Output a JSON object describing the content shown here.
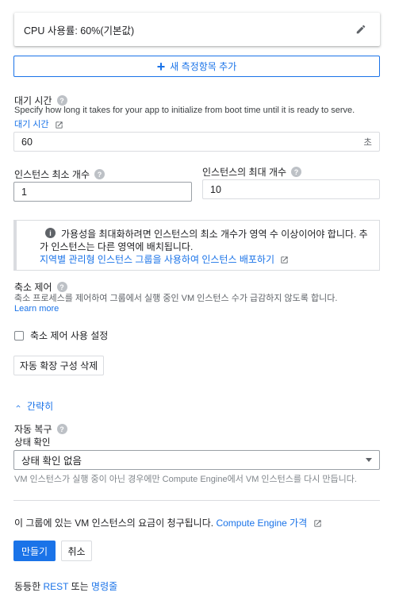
{
  "metric": {
    "label": "CPU 사용률: 60%(기본값)"
  },
  "add_metric": {
    "label": "새 측정항목 추가"
  },
  "cooldown": {
    "title": "대기 시간",
    "description": "Specify how long it takes for your app to initialize from boot time until it is ready to serve.",
    "link": "대기 시간",
    "value": "60",
    "unit": "초"
  },
  "min_instances": {
    "title": "인스턴스 최소 개수",
    "value": "1"
  },
  "max_instances": {
    "title": "인스턴스의 최대 개수",
    "value": "10"
  },
  "info": {
    "line1": "가용성을 최대화하려면 인스턴스의 최소 개수가 영역 수 이상이어야 합니다. 추",
    "line2": "가 인스턴스는 다른 영역에 배치됩니다.",
    "link": "지역별 관리형 인스턴스 그룹을 사용하여 인스턴스 배포하기"
  },
  "scale_in": {
    "title": "축소 제어",
    "description": "축소 프로세스를 제어하여 그룹에서 실행 중인 VM 인스턴스 수가 급감하지 않도록 합니다.",
    "learn_more": "Learn more",
    "checkbox_label": "축소 제어 사용 설정"
  },
  "delete_autoscaling": {
    "label": "자동 확장 구성 삭제"
  },
  "collapse": {
    "label": "간략히"
  },
  "autohealing": {
    "title": "자동 복구",
    "health_check_label": "상태 확인",
    "selected": "상태 확인 없음",
    "hint": "VM 인스턴스가 실행 중이 아닌 경우에만 Compute Engine에서 VM 인스턴스를 다시 만듭니다."
  },
  "billing": {
    "text": "이 그룹에 있는 VM 인스턴스의 요금이 청구됩니다.",
    "link": "Compute Engine 가격"
  },
  "actions": {
    "create": "만들기",
    "cancel": "취소"
  },
  "equivalent": {
    "prefix": "동등한",
    "rest": "REST",
    "middle": "또는",
    "cli": "명령줄"
  }
}
